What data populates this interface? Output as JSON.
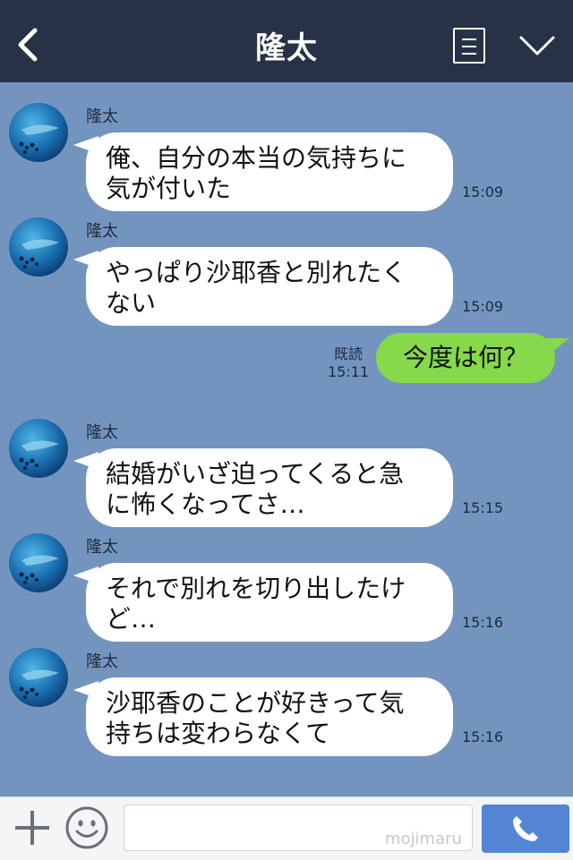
{
  "header": {
    "title": "隆太",
    "back_icon": "chevron-left-icon",
    "menu_icon": "list-icon",
    "dropdown_icon": "chevron-down-icon"
  },
  "messages": [
    {
      "side": "left",
      "sender": "隆太",
      "text": "俺、自分の本当の気持ちに\n気が付いた",
      "time": "15:09"
    },
    {
      "side": "left",
      "sender": "隆太",
      "text": "やっぱり沙耶香と別れたく\nない",
      "time": "15:09"
    },
    {
      "side": "right",
      "text": "今度は何？",
      "read": "既読",
      "time": "15:11"
    },
    {
      "side": "left",
      "sender": "隆太",
      "text": "結婚がいざ迫ってくると急\nに怖くなってさ…",
      "time": "15:15"
    },
    {
      "side": "left",
      "sender": "隆太",
      "text": "それで別れを切り出したけ\nど…",
      "time": "15:16"
    },
    {
      "side": "left",
      "sender": "隆太",
      "text": "沙耶香のことが好きって気\n持ちは変わらなくて",
      "time": "15:16"
    }
  ],
  "input_bar": {
    "placeholder": "",
    "watermark": "mojimaru",
    "plus_icon": "plus-icon",
    "emoji_icon": "smiley-icon",
    "call_icon": "phone-icon"
  },
  "colors": {
    "header": "#273246",
    "chat_bg": "#7494c0",
    "bubble_in": "#ffffff",
    "bubble_out": "#86d94a",
    "call_button": "#5485d4"
  }
}
